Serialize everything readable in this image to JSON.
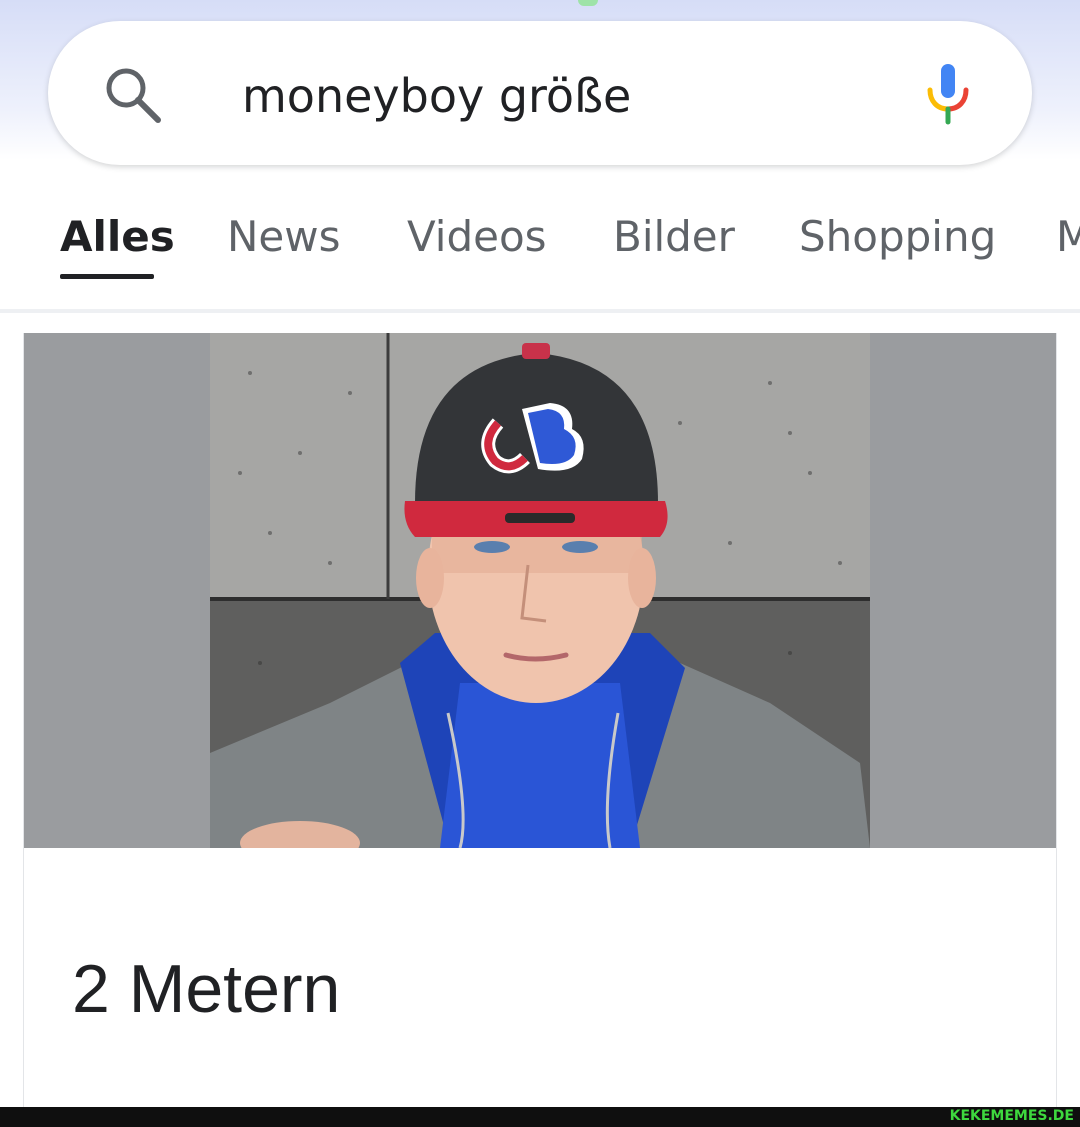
{
  "search": {
    "query": "moneyboy größe"
  },
  "tabs": [
    {
      "label": "Alles",
      "active": true
    },
    {
      "label": "News",
      "active": false
    },
    {
      "label": "Videos",
      "active": false
    },
    {
      "label": "Bilder",
      "active": false
    },
    {
      "label": "Shopping",
      "active": false
    },
    {
      "label": "M",
      "active": false
    }
  ],
  "result": {
    "answer": "2 Metern"
  },
  "watermark": "KEKEMEMES.DE",
  "icons": [
    "search-icon",
    "microphone-icon",
    "person-photo"
  ],
  "colors": {
    "google_blue": "#4285F4",
    "google_red": "#EA4335",
    "google_yellow": "#FBBC05",
    "google_green": "#34A853",
    "text_primary": "#202124",
    "text_secondary": "#5f6368"
  }
}
